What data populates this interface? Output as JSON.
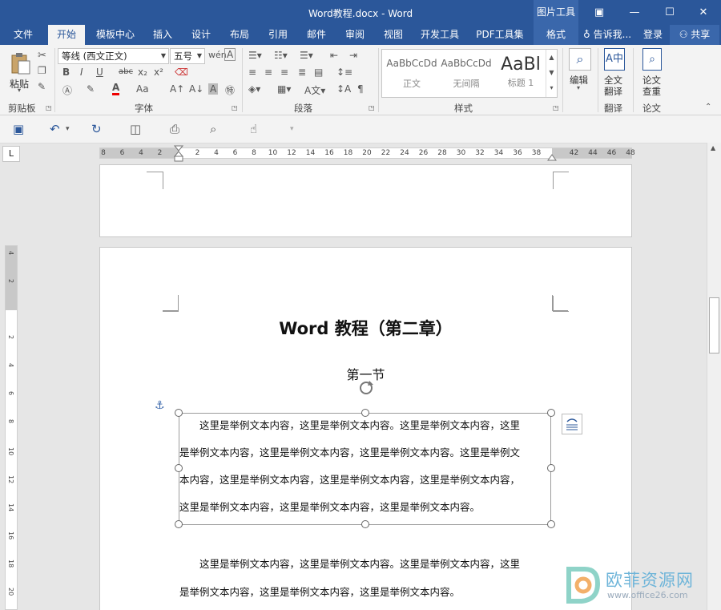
{
  "window": {
    "title": "Word教程.docx - Word",
    "context_tab_group": "图片工具",
    "buttons": {
      "ribbon_display": "▣",
      "minimize": "—",
      "maximize": "☐",
      "close": "✕"
    }
  },
  "tabs": [
    "文件",
    "开始",
    "模板中心",
    "插入",
    "设计",
    "布局",
    "引用",
    "邮件",
    "审阅",
    "视图",
    "开发工具",
    "PDF工具集",
    "格式"
  ],
  "tell_me": "告诉我...",
  "login": "登录",
  "share": "共享",
  "ribbon": {
    "clipboard": {
      "paste_label": "粘贴",
      "group_label": "剪贴板"
    },
    "font": {
      "font_name": "等线 (西文正文)",
      "font_size": "五号",
      "group_label": "字体",
      "buttons": [
        "B",
        "I",
        "U",
        "abc",
        "x₂",
        "x²",
        "A",
        "Aa"
      ]
    },
    "paragraph": {
      "group_label": "段落"
    },
    "styles": {
      "group_label": "样式",
      "items": [
        {
          "preview": "AaBbCcDd",
          "name": "正文"
        },
        {
          "preview": "AaBbCcDd",
          "name": "无间隔"
        },
        {
          "preview": "AaBl",
          "name": "标题 1"
        }
      ]
    },
    "editing": {
      "label": "编辑"
    },
    "translate": {
      "label_line1": "全文",
      "label_line2": "翻译",
      "group_label": "翻译"
    },
    "paper": {
      "label_line1": "论文",
      "label_line2": "查重",
      "group_label": "论文"
    }
  },
  "ruler": {
    "corner_label": "L",
    "horizontal_ticks": [
      "8",
      "6",
      "4",
      "2",
      "",
      "2",
      "4",
      "6",
      "8",
      "10",
      "12",
      "14",
      "16",
      "18",
      "20",
      "22",
      "24",
      "26",
      "28",
      "30",
      "32",
      "34",
      "36",
      "38",
      "",
      "42",
      "44",
      "46",
      "48"
    ],
    "vertical_ticks": [
      "4",
      "2",
      "",
      "2",
      "4",
      "6",
      "8",
      "10",
      "12",
      "14",
      "16",
      "18",
      "20"
    ]
  },
  "document": {
    "title": "Word 教程（第二章）",
    "section": "第一节",
    "textbox_lines": [
      "　　这里是举例文本内容，这里是举例文本内容。这里是举例文本内容，这里",
      "是举例文本内容，这里是举例文本内容，这里是举例文本内容。这里是举例文",
      "本内容，这里是举例文本内容，这里是举例文本内容，这里是举例文本内容，",
      "这里是举例文本内容，这里是举例文本内容，这里是举例文本内容。"
    ],
    "body_lines": [
      "　　这里是举例文本内容，这里是举例文本内容。这里是举例文本内容，这里",
      "是举例文本内容，这里是举例文本内容，这里是举例文本内容。"
    ]
  },
  "watermark": {
    "name": "欧菲资源网",
    "url": "www.office26.com"
  }
}
